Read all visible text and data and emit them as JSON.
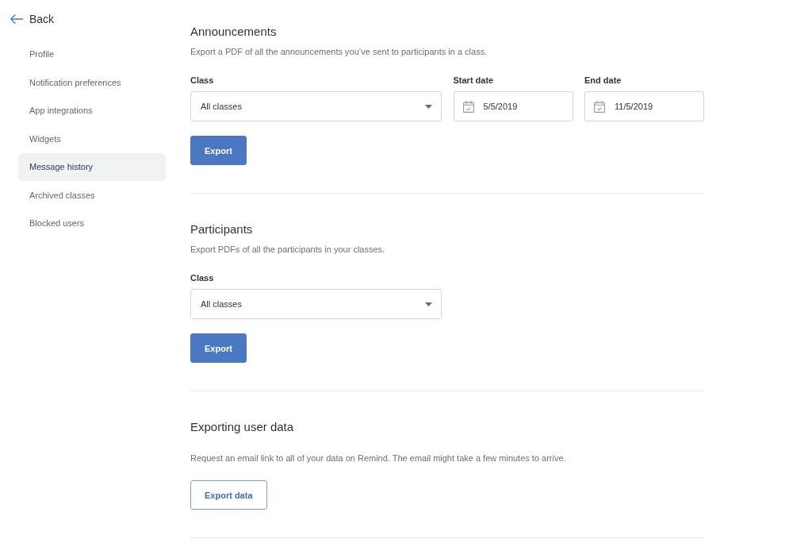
{
  "sidebar": {
    "back": "Back",
    "items": [
      {
        "label": "Profile",
        "selected": false
      },
      {
        "label": "Notification preferences",
        "selected": false
      },
      {
        "label": "App integrations",
        "selected": false
      },
      {
        "label": "Widgets",
        "selected": false
      },
      {
        "label": "Message history",
        "selected": true
      },
      {
        "label": "Archived classes",
        "selected": false
      },
      {
        "label": "Blocked users",
        "selected": false
      }
    ]
  },
  "sections": [
    {
      "title": "Announcements",
      "description": "Export a PDF of all the announcements you’ve sent to participants in a class.",
      "fields": [
        {
          "kind": "select",
          "label": "Class",
          "value": "All classes"
        },
        {
          "kind": "date",
          "label": "Start date",
          "value": "5/5/2019"
        },
        {
          "kind": "date",
          "label": "End date",
          "value": "11/5/2019"
        }
      ],
      "button": {
        "kind": "primary",
        "label": "Export"
      }
    },
    {
      "title": "Participants",
      "description": "Export PDFs of all the participants in your classes.",
      "fields": [
        {
          "kind": "select",
          "label": "Class",
          "value": "All classes"
        }
      ],
      "button": {
        "kind": "primary",
        "label": "Export"
      }
    },
    {
      "title": "Exporting user data",
      "description": "Request an email link to all of your data on Remind. The email might take a few minutes to arrive.",
      "button": {
        "kind": "outline",
        "label": "Export data"
      }
    }
  ]
}
